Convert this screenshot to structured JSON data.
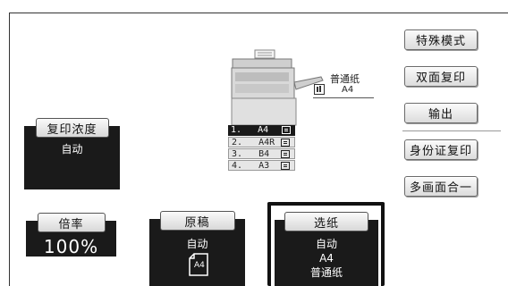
{
  "right_buttons": {
    "special_mode": "特殊模式",
    "duplex": "双面复印",
    "output": "输出",
    "id_card": "身份证复印",
    "multi_page": "多画面合一"
  },
  "paper_display": {
    "paper_type": "普通纸",
    "paper_size": "A4"
  },
  "trays": [
    {
      "num": "1.",
      "size": "A4",
      "selected": true
    },
    {
      "num": "2.",
      "size": "A4R",
      "selected": false
    },
    {
      "num": "3.",
      "size": "B4",
      "selected": false
    },
    {
      "num": "4.",
      "size": "A3",
      "selected": false
    }
  ],
  "density": {
    "label": "复印浓度",
    "value": "自动"
  },
  "ratio": {
    "label": "倍率",
    "value": "100%"
  },
  "original": {
    "label": "原稿",
    "value": "自动",
    "size": "A4"
  },
  "paper_select": {
    "label": "选纸",
    "mode": "自动",
    "size": "A4",
    "type": "普通纸"
  }
}
